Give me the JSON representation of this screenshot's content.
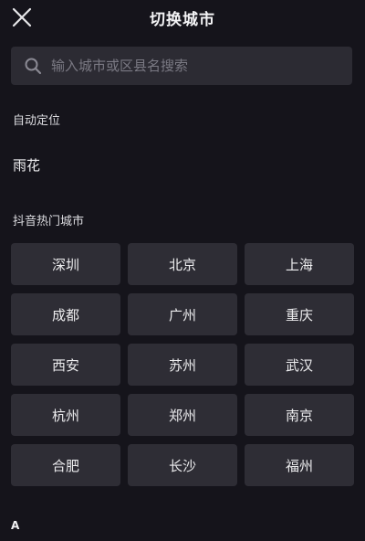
{
  "header": {
    "title": "切换城市"
  },
  "search": {
    "placeholder": "输入城市或区县名搜索"
  },
  "auto_location": {
    "label": "自动定位",
    "city": "雨花"
  },
  "hot_cities": {
    "label": "抖音热门城市",
    "items": [
      "深圳",
      "北京",
      "上海",
      "成都",
      "广州",
      "重庆",
      "西安",
      "苏州",
      "武汉",
      "杭州",
      "郑州",
      "南京",
      "合肥",
      "长沙",
      "福州"
    ]
  },
  "index": {
    "letter": "A"
  },
  "colors": {
    "background": "#15141b",
    "surface": "#2e2d35",
    "text": "#ececee",
    "placeholder": "#7a7983"
  },
  "icons": {
    "close": "close-icon",
    "search": "search-icon"
  }
}
